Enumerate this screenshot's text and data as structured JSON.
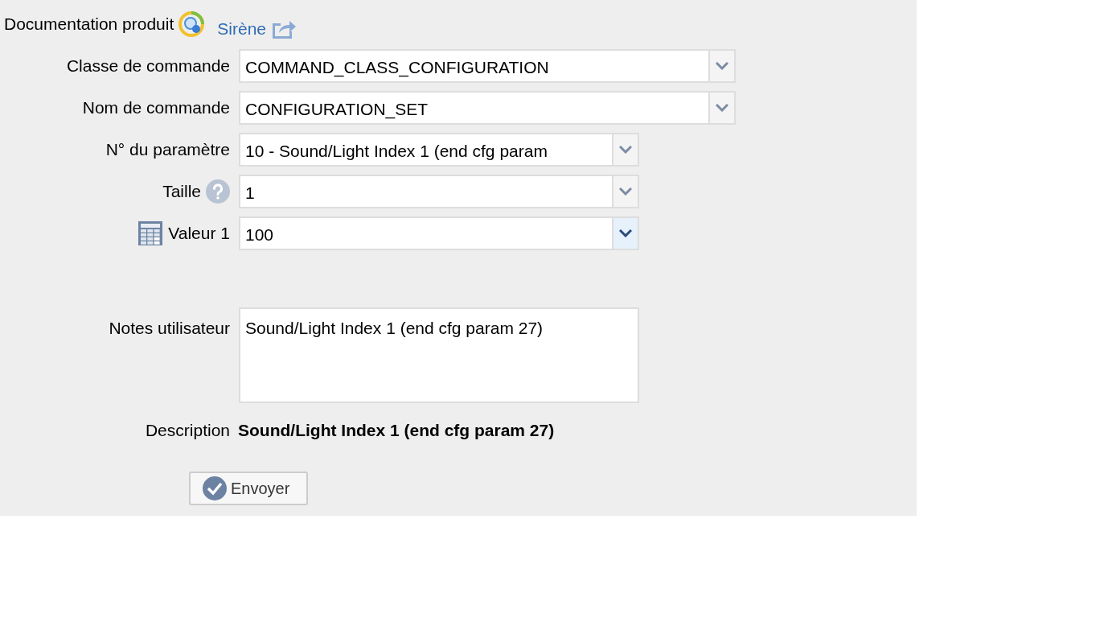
{
  "doc": {
    "label": "Documentation produit",
    "link": "Sirène"
  },
  "fields": [
    {
      "label": "Classe de commande",
      "value": "COMMAND_CLASS_CONFIGURATION",
      "highlighted": false
    },
    {
      "label": "Nom de commande",
      "value": "CONFIGURATION_SET",
      "highlighted": false
    },
    {
      "label": "N° du paramètre",
      "value": "10 - Sound/Light Index 1 (end cfg param",
      "highlighted": false
    },
    {
      "label": "Taille",
      "value": "1",
      "kind": "help",
      "highlighted": false
    },
    {
      "label": "Valeur 1",
      "value": "100",
      "kind": "table",
      "highlighted": true
    }
  ],
  "notes": {
    "label": "Notes utilisateur",
    "value": "Sound/Light Index 1 (end cfg param 27)"
  },
  "description": {
    "label": "Description",
    "value": "Sound/Light Index 1 (end cfg param 27)"
  },
  "submit": "Envoyer"
}
